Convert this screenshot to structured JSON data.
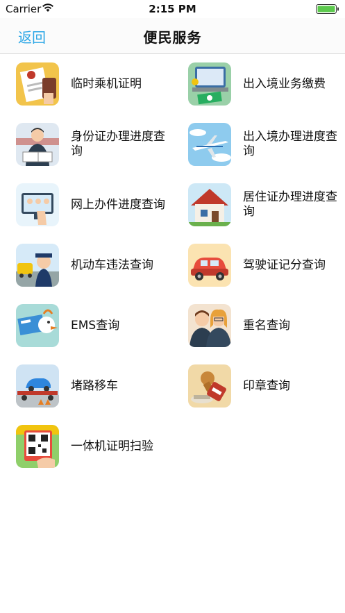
{
  "status_bar": {
    "carrier": "Carrier",
    "time": "2:15 PM",
    "battery_color": "#5cc94d"
  },
  "nav": {
    "back_label": "返回",
    "title": "便民服务",
    "accent_color": "#2aa6e6"
  },
  "services": [
    {
      "label": "临时乘机证明",
      "icon": "boarding-pass-icon"
    },
    {
      "label": "出入境业务缴费",
      "icon": "payment-icon"
    },
    {
      "label": "身份证办理进度查询",
      "icon": "id-card-progress-icon"
    },
    {
      "label": "出入境办理进度查询",
      "icon": "airplane-icon"
    },
    {
      "label": "网上办件进度查询",
      "icon": "online-service-icon"
    },
    {
      "label": "居住证办理进度查询",
      "icon": "house-icon"
    },
    {
      "label": "机动车违法查询",
      "icon": "traffic-police-icon"
    },
    {
      "label": "驾驶证记分查询",
      "icon": "car-icon"
    },
    {
      "label": "EMS查询",
      "icon": "ems-icon"
    },
    {
      "label": "重名查询",
      "icon": "people-icon"
    },
    {
      "label": "堵路移车",
      "icon": "tow-truck-icon"
    },
    {
      "label": "印章查询",
      "icon": "seal-stamp-icon"
    },
    {
      "label": "一体机证明扫验",
      "icon": "qr-scan-icon"
    }
  ]
}
